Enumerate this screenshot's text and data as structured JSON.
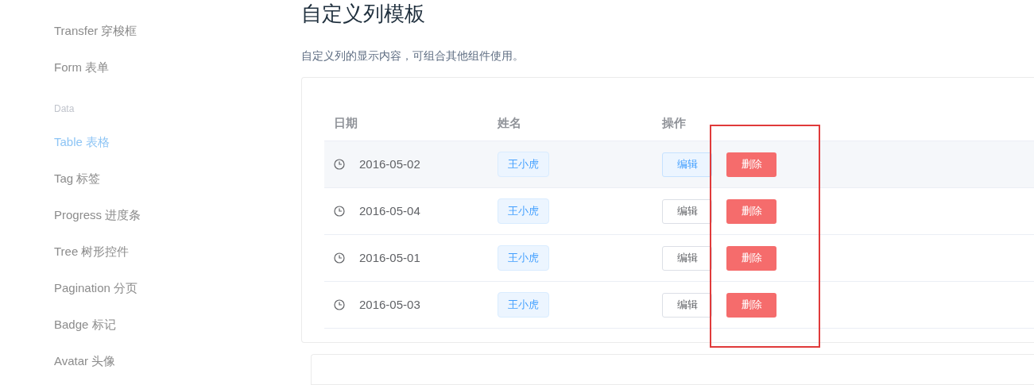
{
  "sidebar": {
    "items": [
      {
        "kind": "link",
        "label": "Transfer 穿梭框",
        "selected": false
      },
      {
        "kind": "link",
        "label": "Form 表单",
        "selected": false
      },
      {
        "kind": "group",
        "label": "Data"
      },
      {
        "kind": "link",
        "label": "Table 表格",
        "selected": true
      },
      {
        "kind": "link",
        "label": "Tag 标签",
        "selected": false
      },
      {
        "kind": "link",
        "label": "Progress 进度条",
        "selected": false
      },
      {
        "kind": "link",
        "label": "Tree 树形控件",
        "selected": false
      },
      {
        "kind": "link",
        "label": "Pagination 分页",
        "selected": false
      },
      {
        "kind": "link",
        "label": "Badge 标记",
        "selected": false
      },
      {
        "kind": "link",
        "label": "Avatar 头像",
        "selected": false
      }
    ]
  },
  "heading": "自定义列模板",
  "description": "自定义列的显示内容，可组合其他组件使用。",
  "table": {
    "columns": [
      "日期",
      "姓名",
      "操作"
    ],
    "rows": [
      {
        "date": "2016-05-02",
        "name": "王小虎",
        "edit": "编辑",
        "delete": "删除",
        "hovered": true
      },
      {
        "date": "2016-05-04",
        "name": "王小虎",
        "edit": "编辑",
        "delete": "删除",
        "hovered": false
      },
      {
        "date": "2016-05-01",
        "name": "王小虎",
        "edit": "编辑",
        "delete": "删除",
        "hovered": false
      },
      {
        "date": "2016-05-03",
        "name": "王小虎",
        "edit": "编辑",
        "delete": "删除",
        "hovered": false
      }
    ]
  },
  "annotation": {
    "visible": true
  }
}
